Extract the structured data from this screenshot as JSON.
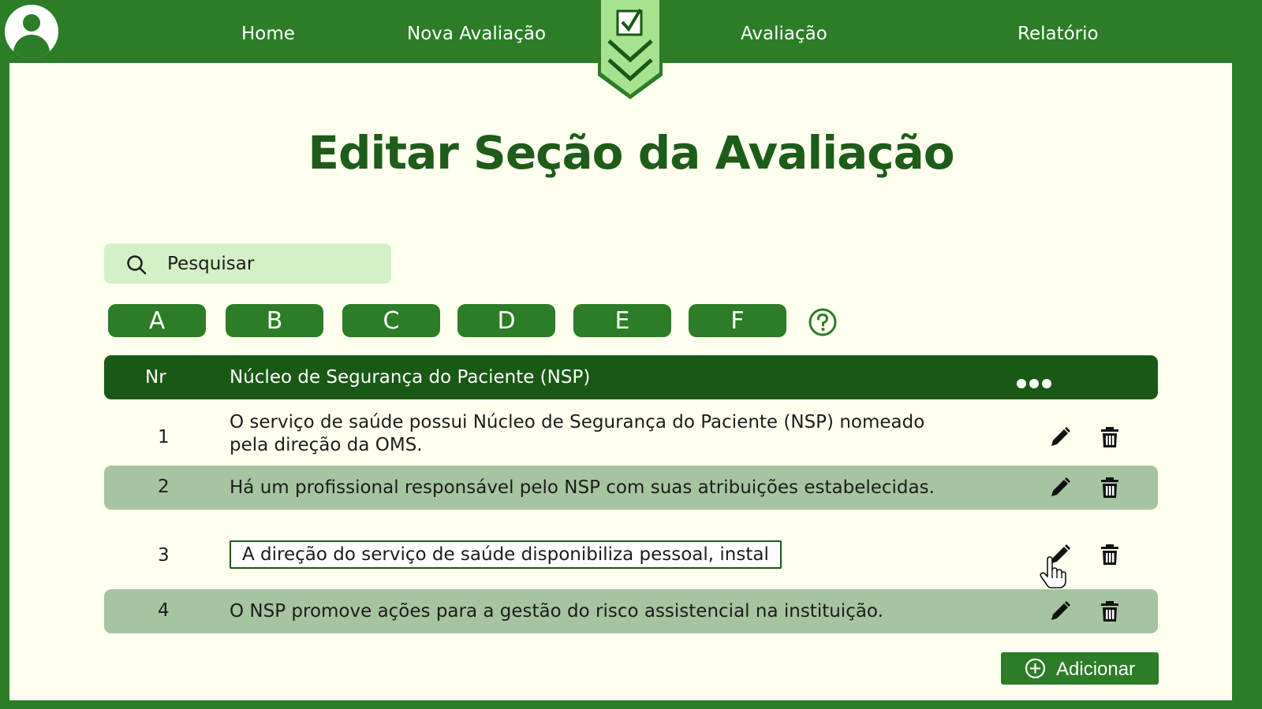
{
  "nav": {
    "items": [
      {
        "label": "Home"
      },
      {
        "label": "Nova Avaliação"
      },
      {
        "label": "Avaliação"
      },
      {
        "label": "Relatório"
      }
    ],
    "avatar_icon": "user-icon",
    "logo_icon": "checkmark-shield-icon"
  },
  "page": {
    "title": "Editar Seção da Avaliação"
  },
  "search": {
    "placeholder": "Pesquisar",
    "icon": "search-icon"
  },
  "sections": [
    "A",
    "B",
    "C",
    "D",
    "E",
    "F"
  ],
  "help_icon": "question-circle-icon",
  "table": {
    "headers": {
      "nr": "Nr",
      "title": "Núcleo de Segurança do Paciente (NSP)",
      "menu_icon": "more-dots-icon"
    },
    "rows": [
      {
        "nr": "1",
        "text": "O serviço de saúde possui Núcleo de Segurança do Paciente (NSP) nomeado pela direção da OMS."
      },
      {
        "nr": "2",
        "text": "Há um profissional responsável pelo NSP com suas atribuições estabelecidas."
      },
      {
        "nr": "3",
        "text": "A direção do serviço de saúde disponibiliza pessoal, instalaç",
        "editing": true
      },
      {
        "nr": "4",
        "text": "O NSP promove ações para a gestão do risco assistencial na instituição."
      }
    ],
    "row_actions": [
      "pencil-icon",
      "trash-icon"
    ]
  },
  "add_button": {
    "label": "Adicionar",
    "icon": "plus-circle-icon"
  },
  "colors": {
    "brand": "#2c7c28",
    "header": "#1a5816",
    "background": "#fffff0",
    "alt_row": "#a7c4a0",
    "search_bg": "#d4f0c6",
    "title": "#1e5c19"
  }
}
